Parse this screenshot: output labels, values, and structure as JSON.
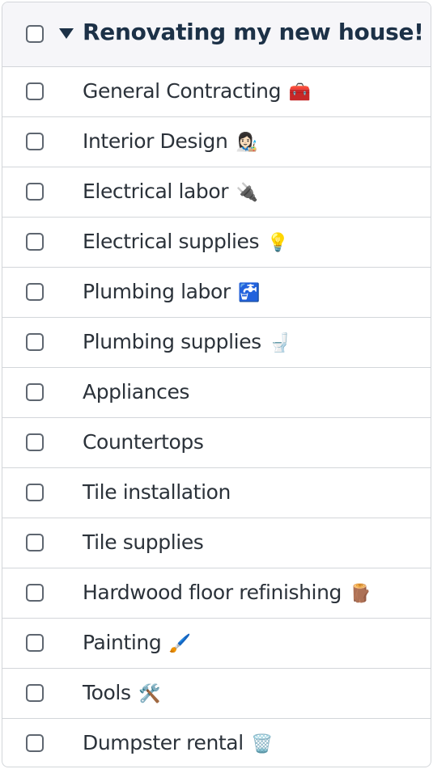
{
  "group": {
    "title": "Renovating my new house!",
    "expanded": true
  },
  "items": [
    {
      "label": "General Contracting",
      "emoji": "🧰",
      "icon": "toolbox-icon"
    },
    {
      "label": "Interior Design",
      "emoji": "👩🏻‍🎨",
      "icon": "artist-icon"
    },
    {
      "label": "Electrical labor",
      "emoji": "🔌",
      "icon": "plug-icon"
    },
    {
      "label": "Electrical supplies",
      "emoji": "💡",
      "icon": "lightbulb-icon"
    },
    {
      "label": "Plumbing labor",
      "emoji": "🚰",
      "icon": "faucet-icon"
    },
    {
      "label": "Plumbing supplies",
      "emoji": "🚽",
      "icon": "toilet-icon"
    },
    {
      "label": "Appliances",
      "emoji": "",
      "icon": ""
    },
    {
      "label": "Countertops",
      "emoji": "",
      "icon": ""
    },
    {
      "label": "Tile installation",
      "emoji": "",
      "icon": ""
    },
    {
      "label": "Tile supplies",
      "emoji": "",
      "icon": ""
    },
    {
      "label": "Hardwood floor refinishing",
      "emoji": "🪵",
      "icon": "wood-icon"
    },
    {
      "label": "Painting",
      "emoji": "🖌️",
      "icon": "paintbrush-icon"
    },
    {
      "label": "Tools",
      "emoji": "🛠️",
      "icon": "tools-icon"
    },
    {
      "label": "Dumpster rental",
      "emoji": "🗑️",
      "icon": "wastebasket-icon"
    }
  ]
}
